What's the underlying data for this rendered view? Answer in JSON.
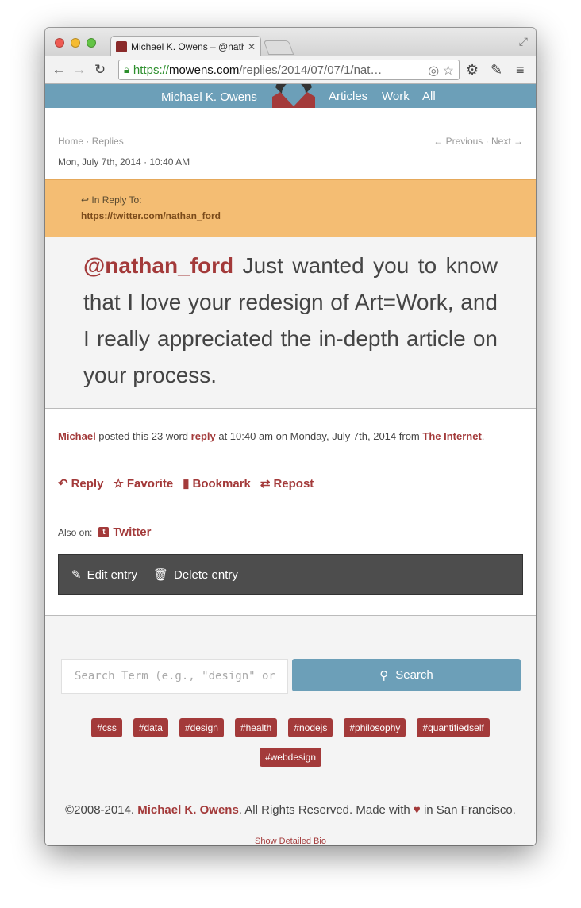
{
  "browser": {
    "tab_title": "Michael K. Owens – @nath",
    "url_scheme": "https://",
    "url_host": "mowens.com",
    "url_path": "/replies/2014/07/07/1/nat…"
  },
  "site": {
    "name": "Michael K. Owens",
    "nav": [
      "Articles",
      "Work",
      "All"
    ]
  },
  "breadcrumb": {
    "home": "Home",
    "sep": " · ",
    "section": "Replies"
  },
  "pager": {
    "previous": "← Previous",
    "sep": " · ",
    "next": "Next →"
  },
  "date": "Mon, July 7th, 2014 · 10:40 AM",
  "in_reply": {
    "label": "In Reply To:",
    "url": "https://twitter.com/nathan_ford"
  },
  "post": {
    "mention": "@nathan_ford",
    "text": " Just wanted you to know that I love your redesign of Art=Work, and I really appreciated the in-depth article on your process."
  },
  "meta": {
    "author": "Michael",
    "t1": " posted this 23 word ",
    "type": "reply",
    "t2": " at 10:40 am on Monday, July 7th, 2014 from ",
    "source": "The Internet",
    "t3": "."
  },
  "actions": {
    "reply": "Reply",
    "favorite": "Favorite",
    "bookmark": "Bookmark",
    "repost": "Repost"
  },
  "also_on": {
    "label": "Also on:",
    "twitter": "Twitter"
  },
  "admin": {
    "edit": "Edit entry",
    "delete": "Delete entry"
  },
  "search": {
    "placeholder": "Search Term (e.g., \"design\" or \"",
    "button": "Search"
  },
  "tags": [
    "#css",
    "#data",
    "#design",
    "#health",
    "#nodejs",
    "#philosophy",
    "#quantifiedself",
    "#webdesign"
  ],
  "footer": {
    "copyright": "©2008-2014. ",
    "owner": "Michael K. Owens",
    "rights": ". All Rights Reserved. Made with ",
    "heart": "♥",
    "location": " in San Francisco.",
    "bio_link": "Show Detailed Bio"
  },
  "colors": {
    "accent": "#a33a3a",
    "bar": "#6c9fb8",
    "reply_bg": "#f4bd73"
  }
}
